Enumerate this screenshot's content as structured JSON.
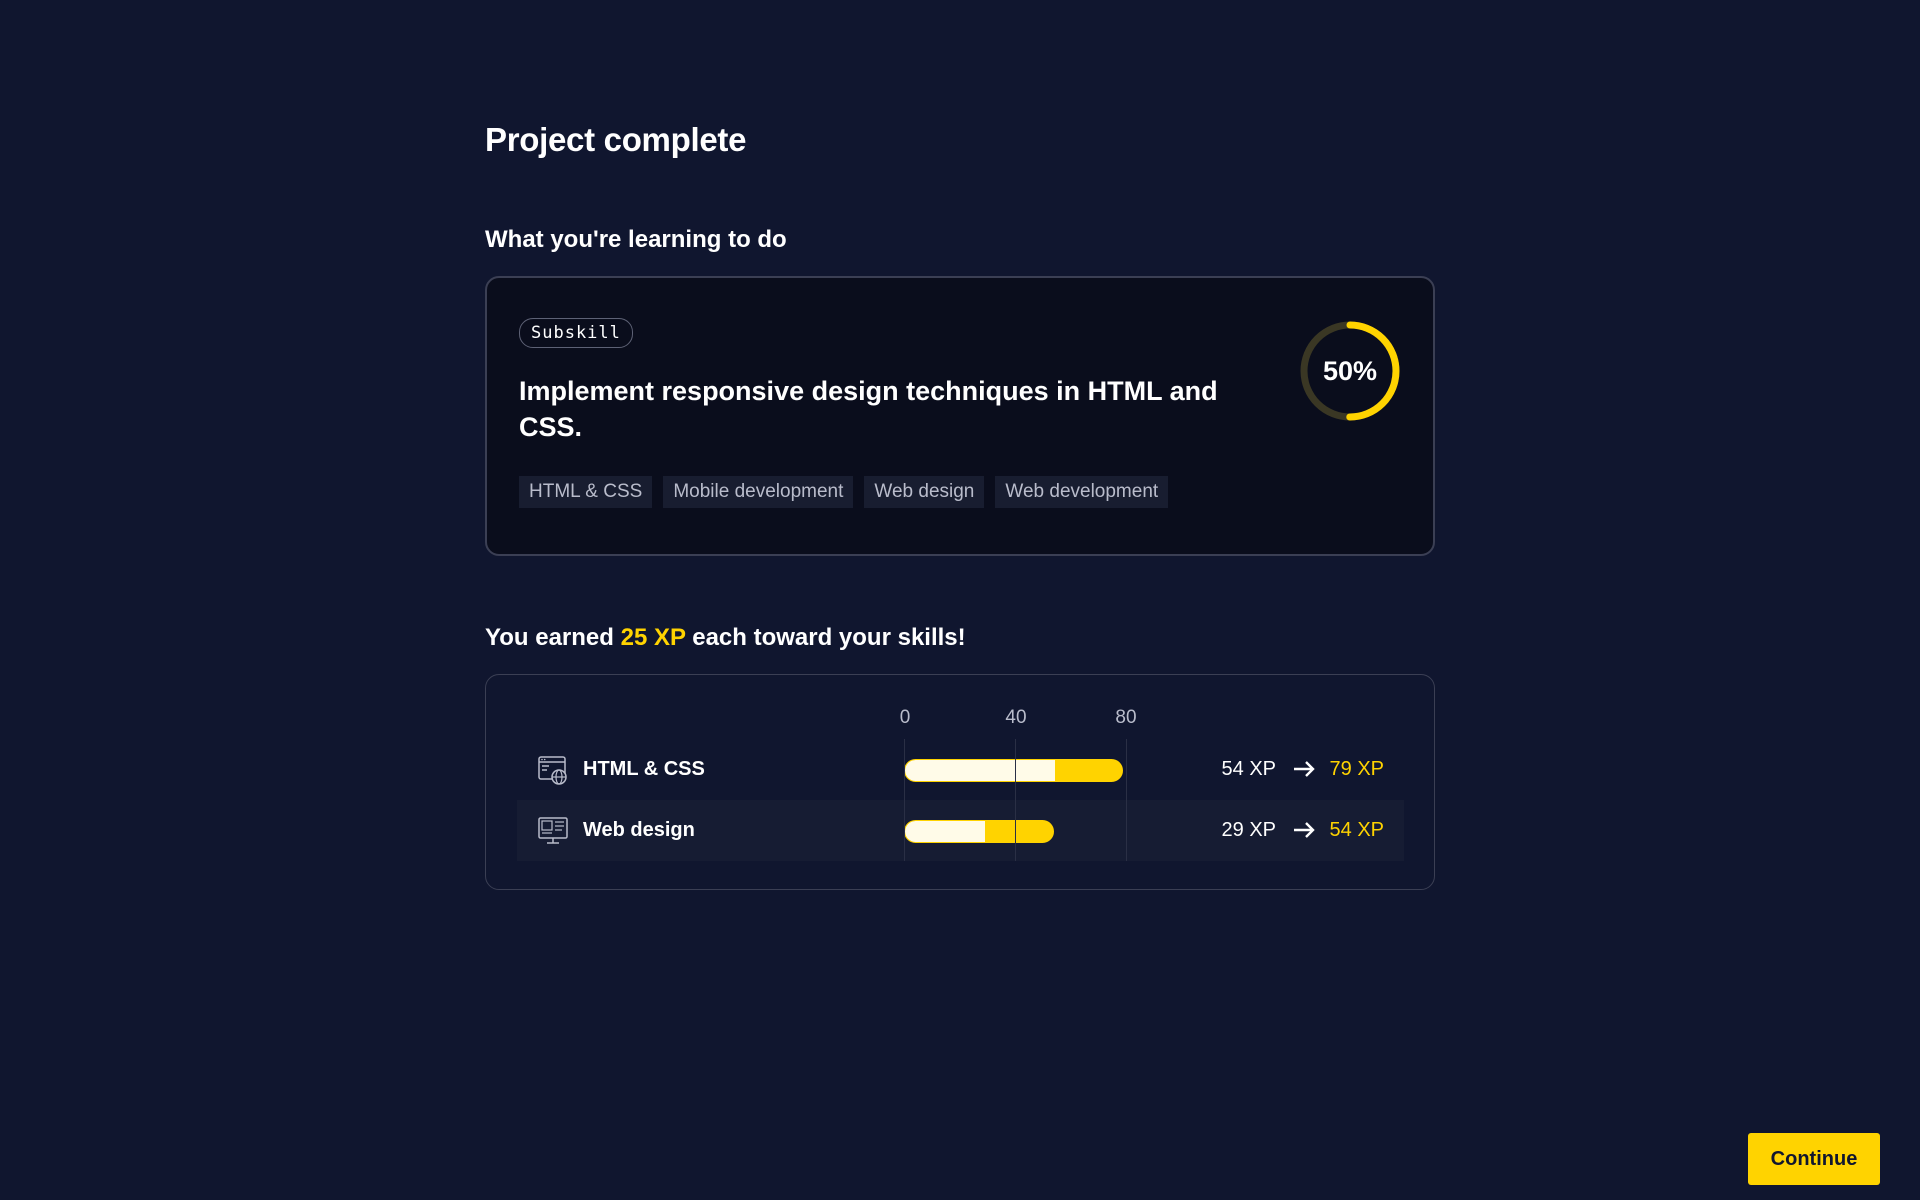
{
  "page": {
    "title": "Project complete"
  },
  "learning": {
    "heading": "What you're learning to do",
    "badge": "Subskill",
    "skill_title": "Implement responsive design techniques in HTML and CSS.",
    "progress_percent": 50,
    "progress_label": "50%",
    "tags": [
      "HTML & CSS",
      "Mobile development",
      "Web design",
      "Web development"
    ]
  },
  "xp": {
    "heading_prefix": "You earned ",
    "heading_amount": "25 XP",
    "heading_suffix": " each toward your skills!",
    "axis_ticks": [
      "0",
      "40",
      "80"
    ],
    "axis_max": 80,
    "rows": [
      {
        "icon": "browser-globe-icon",
        "name": "HTML & CSS",
        "from_value": 54,
        "to_value": 79,
        "from_label": "54 XP",
        "to_label": "79 XP"
      },
      {
        "icon": "monitor-layout-icon",
        "name": "Web design",
        "from_value": 29,
        "to_value": 54,
        "from_label": "29 XP",
        "to_label": "54 XP"
      }
    ]
  },
  "actions": {
    "continue_label": "Continue"
  },
  "colors": {
    "background": "#10162f",
    "accent": "#ffd300",
    "card": "#0a0d1c",
    "previous_xp": "#fffbe8"
  }
}
